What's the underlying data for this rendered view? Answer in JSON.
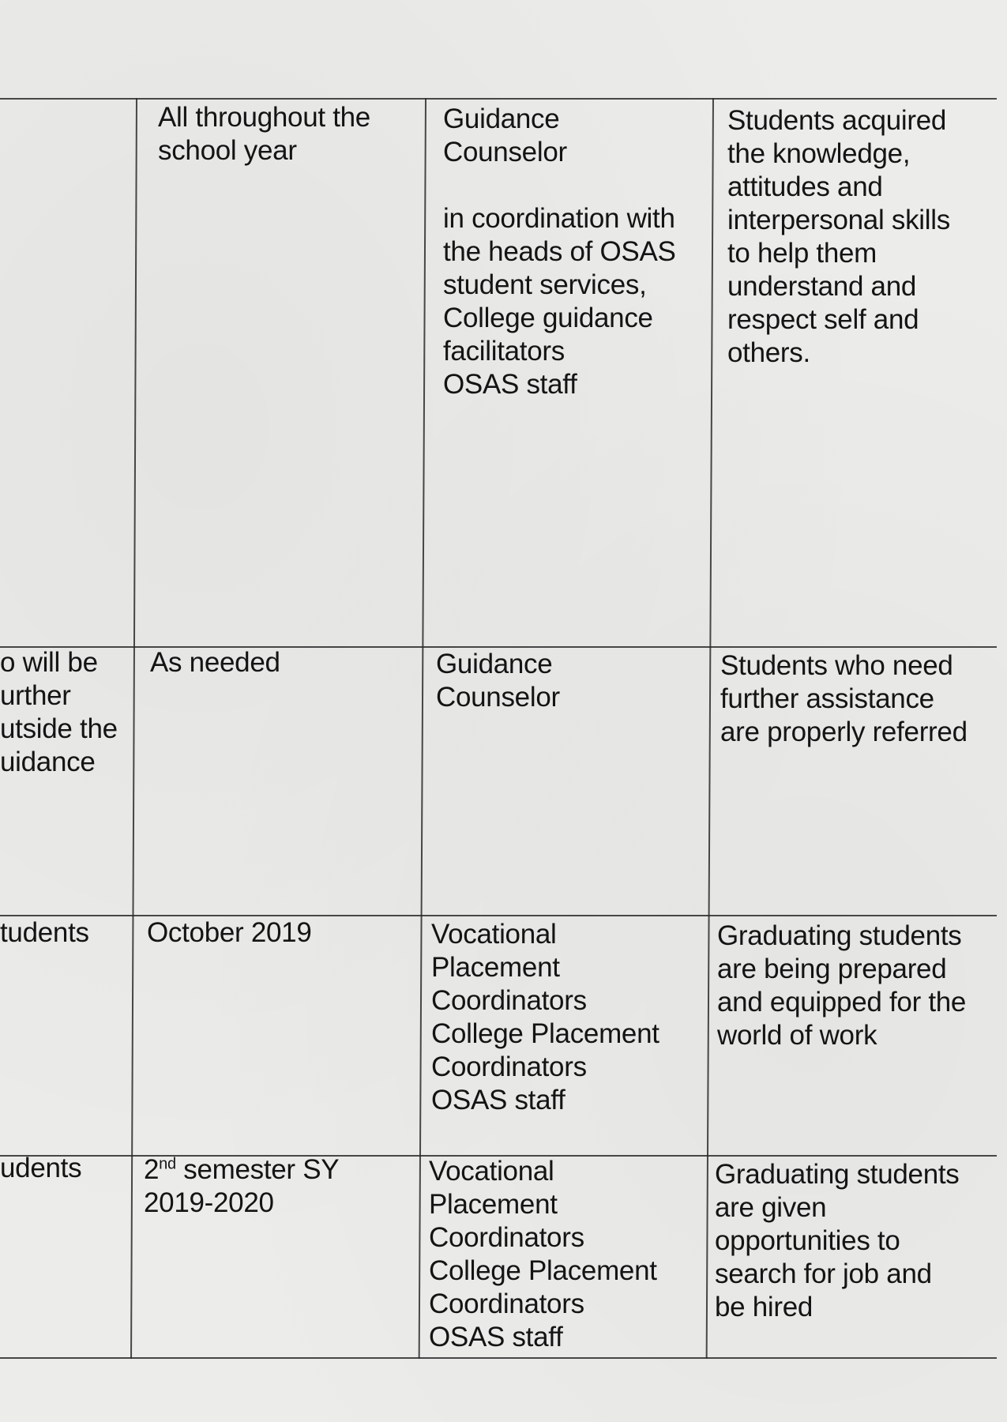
{
  "rows": [
    {
      "activity": [],
      "timeframe": [
        "All throughout the",
        "school year"
      ],
      "persons_responsible": [
        "Guidance",
        "Counselor"
      ],
      "persons_responsible_extra": [
        "in coordination with",
        "the heads of OSAS",
        "student services,",
        "College guidance",
        "facilitators",
        "OSAS staff"
      ],
      "expected_outcome": [
        "Students acquired",
        "the knowledge,",
        "attitudes and",
        "interpersonal skills",
        "to help them",
        "understand and",
        "respect self and",
        "others."
      ]
    },
    {
      "activity": [
        "o will be",
        "urther",
        "utside the",
        "uidance"
      ],
      "timeframe": [
        "As needed"
      ],
      "persons_responsible": [
        "Guidance",
        "Counselor"
      ],
      "expected_outcome": [
        "Students who need",
        "further assistance",
        "are properly referred"
      ]
    },
    {
      "activity": [
        "tudents"
      ],
      "timeframe": [
        "October 2019"
      ],
      "persons_responsible": [
        "Vocational",
        "Placement",
        "Coordinators",
        "College Placement",
        "Coordinators",
        "OSAS staff"
      ],
      "expected_outcome": [
        "Graduating students",
        "are being prepared",
        "and equipped for the",
        "world of work"
      ]
    },
    {
      "activity": [
        "udents"
      ],
      "timeframe_num": "2",
      "timeframe_sup": "nd",
      "timeframe_rest": " semester SY",
      "timeframe_line2": "2019-2020",
      "persons_responsible": [
        "Vocational",
        "Placement",
        "Coordinators",
        "College Placement",
        "Coordinators",
        "OSAS staff"
      ],
      "expected_outcome": [
        "Graduating students",
        "are given",
        "opportunities to",
        "search for job and",
        "be hired"
      ]
    }
  ]
}
